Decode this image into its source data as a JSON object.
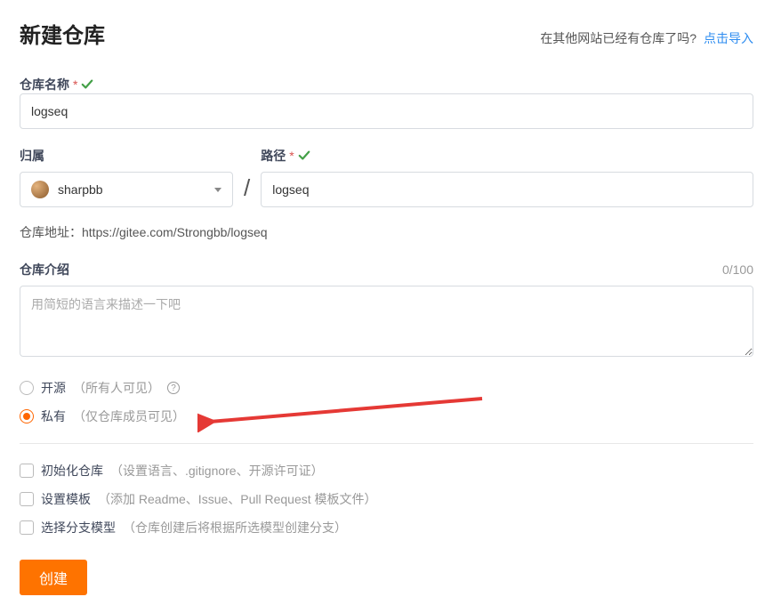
{
  "header": {
    "title": "新建仓库",
    "import_prompt": "在其他网站已经有仓库了吗?",
    "import_link": "点击导入"
  },
  "name": {
    "label": "仓库名称",
    "value": "logseq"
  },
  "owner": {
    "label": "归属",
    "value": "sharpbb"
  },
  "path": {
    "label": "路径",
    "value": "logseq"
  },
  "address": {
    "label": "仓库地址：",
    "value": "https://gitee.com/Strongbb/logseq"
  },
  "intro": {
    "label": "仓库介绍",
    "counter": "0/100",
    "placeholder": "用简短的语言来描述一下吧"
  },
  "visibility": {
    "public_label": "开源",
    "public_hint": "（所有人可见）",
    "private_label": "私有",
    "private_hint": "（仅仓库成员可见）"
  },
  "options": {
    "init_label": "初始化仓库",
    "init_hint": "（设置语言、.gitignore、开源许可证）",
    "template_label": "设置模板",
    "template_hint": "（添加 Readme、Issue、Pull Request 模板文件）",
    "branch_label": "选择分支模型",
    "branch_hint": "（仓库创建后将根据所选模型创建分支）"
  },
  "submit": {
    "label": "创建"
  }
}
